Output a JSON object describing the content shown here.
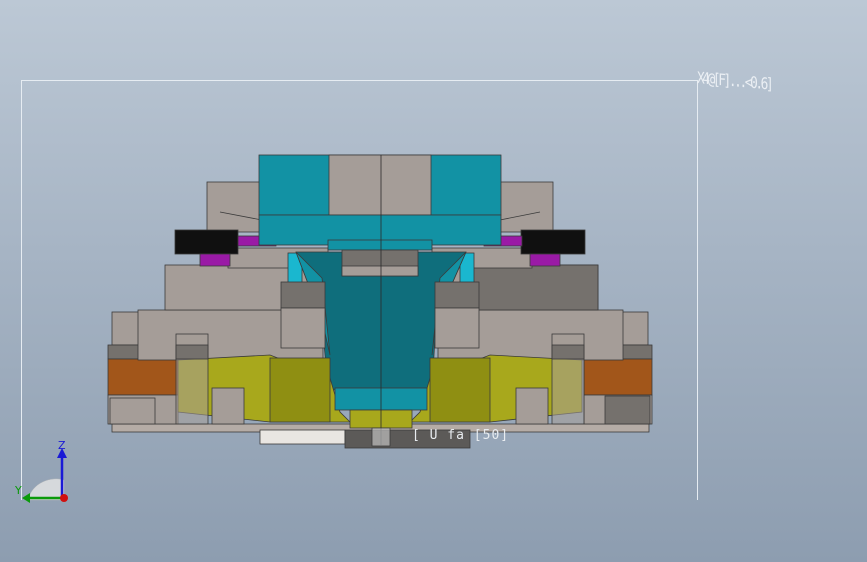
{
  "window": {
    "title": "",
    "view": "Front"
  },
  "overlay": {
    "stacked_annotation": "X4@[F]...<0.6]",
    "dimension_text": "[ U fa [50]"
  },
  "triad": {
    "z_label": "Z",
    "y_label": "Y",
    "colors": {
      "z": "#1a1ad6",
      "y": "#0a9a0a",
      "x": "#d01010"
    }
  },
  "palette": {
    "background_top": "#bcc8d5",
    "background_bottom": "#8d9db0",
    "teal": "#1292a4",
    "dark_teal": "#0f6e7c",
    "gray": "#a59d98",
    "dark_gray": "#75716d",
    "magenta": "#9a1aa6",
    "black": "#101010",
    "olive": "#a8a81c",
    "orange": "#a2561a",
    "cyan": "#1ab7cf"
  }
}
